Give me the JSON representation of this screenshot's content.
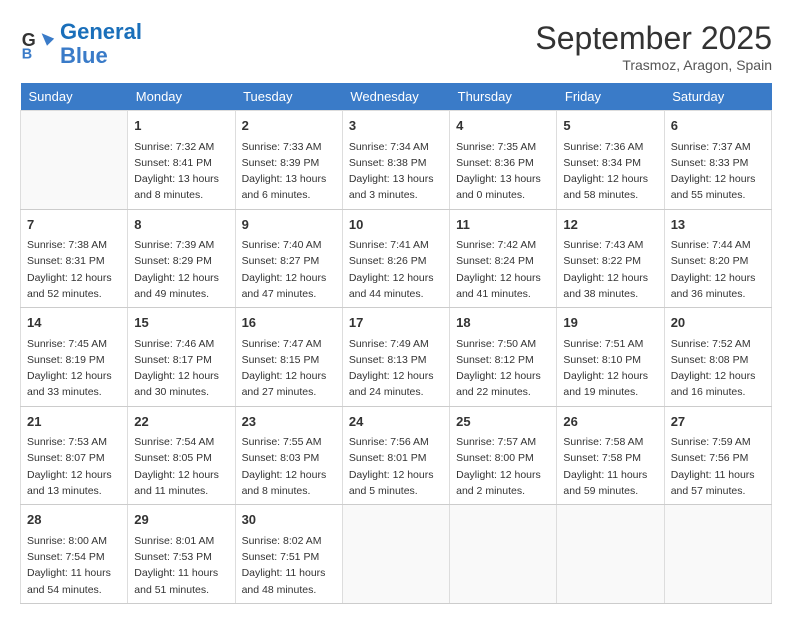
{
  "header": {
    "logo_line1": "General",
    "logo_line2": "Blue",
    "month": "September 2025",
    "location": "Trasmoz, Aragon, Spain"
  },
  "weekdays": [
    "Sunday",
    "Monday",
    "Tuesday",
    "Wednesday",
    "Thursday",
    "Friday",
    "Saturday"
  ],
  "weeks": [
    [
      {
        "day": "",
        "info": ""
      },
      {
        "day": "1",
        "info": "Sunrise: 7:32 AM\nSunset: 8:41 PM\nDaylight: 13 hours\nand 8 minutes."
      },
      {
        "day": "2",
        "info": "Sunrise: 7:33 AM\nSunset: 8:39 PM\nDaylight: 13 hours\nand 6 minutes."
      },
      {
        "day": "3",
        "info": "Sunrise: 7:34 AM\nSunset: 8:38 PM\nDaylight: 13 hours\nand 3 minutes."
      },
      {
        "day": "4",
        "info": "Sunrise: 7:35 AM\nSunset: 8:36 PM\nDaylight: 13 hours\nand 0 minutes."
      },
      {
        "day": "5",
        "info": "Sunrise: 7:36 AM\nSunset: 8:34 PM\nDaylight: 12 hours\nand 58 minutes."
      },
      {
        "day": "6",
        "info": "Sunrise: 7:37 AM\nSunset: 8:33 PM\nDaylight: 12 hours\nand 55 minutes."
      }
    ],
    [
      {
        "day": "7",
        "info": "Sunrise: 7:38 AM\nSunset: 8:31 PM\nDaylight: 12 hours\nand 52 minutes."
      },
      {
        "day": "8",
        "info": "Sunrise: 7:39 AM\nSunset: 8:29 PM\nDaylight: 12 hours\nand 49 minutes."
      },
      {
        "day": "9",
        "info": "Sunrise: 7:40 AM\nSunset: 8:27 PM\nDaylight: 12 hours\nand 47 minutes."
      },
      {
        "day": "10",
        "info": "Sunrise: 7:41 AM\nSunset: 8:26 PM\nDaylight: 12 hours\nand 44 minutes."
      },
      {
        "day": "11",
        "info": "Sunrise: 7:42 AM\nSunset: 8:24 PM\nDaylight: 12 hours\nand 41 minutes."
      },
      {
        "day": "12",
        "info": "Sunrise: 7:43 AM\nSunset: 8:22 PM\nDaylight: 12 hours\nand 38 minutes."
      },
      {
        "day": "13",
        "info": "Sunrise: 7:44 AM\nSunset: 8:20 PM\nDaylight: 12 hours\nand 36 minutes."
      }
    ],
    [
      {
        "day": "14",
        "info": "Sunrise: 7:45 AM\nSunset: 8:19 PM\nDaylight: 12 hours\nand 33 minutes."
      },
      {
        "day": "15",
        "info": "Sunrise: 7:46 AM\nSunset: 8:17 PM\nDaylight: 12 hours\nand 30 minutes."
      },
      {
        "day": "16",
        "info": "Sunrise: 7:47 AM\nSunset: 8:15 PM\nDaylight: 12 hours\nand 27 minutes."
      },
      {
        "day": "17",
        "info": "Sunrise: 7:49 AM\nSunset: 8:13 PM\nDaylight: 12 hours\nand 24 minutes."
      },
      {
        "day": "18",
        "info": "Sunrise: 7:50 AM\nSunset: 8:12 PM\nDaylight: 12 hours\nand 22 minutes."
      },
      {
        "day": "19",
        "info": "Sunrise: 7:51 AM\nSunset: 8:10 PM\nDaylight: 12 hours\nand 19 minutes."
      },
      {
        "day": "20",
        "info": "Sunrise: 7:52 AM\nSunset: 8:08 PM\nDaylight: 12 hours\nand 16 minutes."
      }
    ],
    [
      {
        "day": "21",
        "info": "Sunrise: 7:53 AM\nSunset: 8:07 PM\nDaylight: 12 hours\nand 13 minutes."
      },
      {
        "day": "22",
        "info": "Sunrise: 7:54 AM\nSunset: 8:05 PM\nDaylight: 12 hours\nand 11 minutes."
      },
      {
        "day": "23",
        "info": "Sunrise: 7:55 AM\nSunset: 8:03 PM\nDaylight: 12 hours\nand 8 minutes."
      },
      {
        "day": "24",
        "info": "Sunrise: 7:56 AM\nSunset: 8:01 PM\nDaylight: 12 hours\nand 5 minutes."
      },
      {
        "day": "25",
        "info": "Sunrise: 7:57 AM\nSunset: 8:00 PM\nDaylight: 12 hours\nand 2 minutes."
      },
      {
        "day": "26",
        "info": "Sunrise: 7:58 AM\nSunset: 7:58 PM\nDaylight: 11 hours\nand 59 minutes."
      },
      {
        "day": "27",
        "info": "Sunrise: 7:59 AM\nSunset: 7:56 PM\nDaylight: 11 hours\nand 57 minutes."
      }
    ],
    [
      {
        "day": "28",
        "info": "Sunrise: 8:00 AM\nSunset: 7:54 PM\nDaylight: 11 hours\nand 54 minutes."
      },
      {
        "day": "29",
        "info": "Sunrise: 8:01 AM\nSunset: 7:53 PM\nDaylight: 11 hours\nand 51 minutes."
      },
      {
        "day": "30",
        "info": "Sunrise: 8:02 AM\nSunset: 7:51 PM\nDaylight: 11 hours\nand 48 minutes."
      },
      {
        "day": "",
        "info": ""
      },
      {
        "day": "",
        "info": ""
      },
      {
        "day": "",
        "info": ""
      },
      {
        "day": "",
        "info": ""
      }
    ]
  ]
}
